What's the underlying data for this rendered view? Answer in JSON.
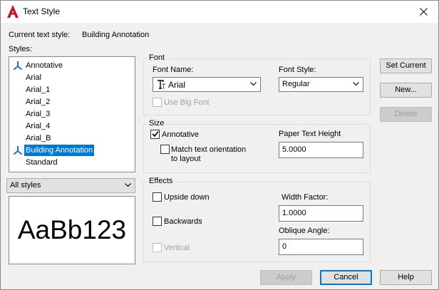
{
  "window": {
    "title": "Text Style",
    "icon": "autocad-icon",
    "close_icon": "close-icon"
  },
  "current_style": {
    "label": "Current text style:",
    "value": "Building Annotation"
  },
  "styles": {
    "label": "Styles:",
    "items": [
      {
        "label": "Annotative",
        "annotative": true,
        "selected": false
      },
      {
        "label": "Arial",
        "annotative": false,
        "selected": false
      },
      {
        "label": "Arial_1",
        "annotative": false,
        "selected": false
      },
      {
        "label": "Arial_2",
        "annotative": false,
        "selected": false
      },
      {
        "label": "Arial_3",
        "annotative": false,
        "selected": false
      },
      {
        "label": "Arial_4",
        "annotative": false,
        "selected": false
      },
      {
        "label": "Arial_B",
        "annotative": false,
        "selected": false
      },
      {
        "label": "Building Annotation",
        "annotative": true,
        "selected": true
      },
      {
        "label": "Standard",
        "annotative": false,
        "selected": false
      }
    ],
    "filter_value": "All styles",
    "preview_text": "AaBb123"
  },
  "font": {
    "group_label": "Font",
    "name_label": "Font Name:",
    "name_value": "Arial",
    "style_label": "Font Style:",
    "style_value": "Regular",
    "big_font_label": "Use Big Font",
    "big_font_checked": false
  },
  "size": {
    "group_label": "Size",
    "annotative_label": "Annotative",
    "annotative_checked": true,
    "match_orientation_label_line1": "Match text orientation",
    "match_orientation_label_line2": "to layout",
    "match_orientation_checked": false,
    "paper_height_label": "Paper Text Height",
    "paper_height_value": "5.0000"
  },
  "effects": {
    "group_label": "Effects",
    "upside_down_label": "Upside down",
    "upside_down_checked": false,
    "backwards_label": "Backwards",
    "backwards_checked": false,
    "vertical_label": "Vertical",
    "vertical_checked": false,
    "width_factor_label": "Width Factor:",
    "width_factor_value": "1.0000",
    "oblique_label": "Oblique Angle:",
    "oblique_value": "0"
  },
  "buttons": {
    "set_current": "Set Current",
    "new": "New...",
    "delete": "Delete",
    "apply": "Apply",
    "cancel": "Cancel",
    "help": "Help"
  },
  "colors": {
    "accent": "#0078d7",
    "annotative_icon": "#1e6fd0",
    "app_icon": "#c8102e"
  }
}
